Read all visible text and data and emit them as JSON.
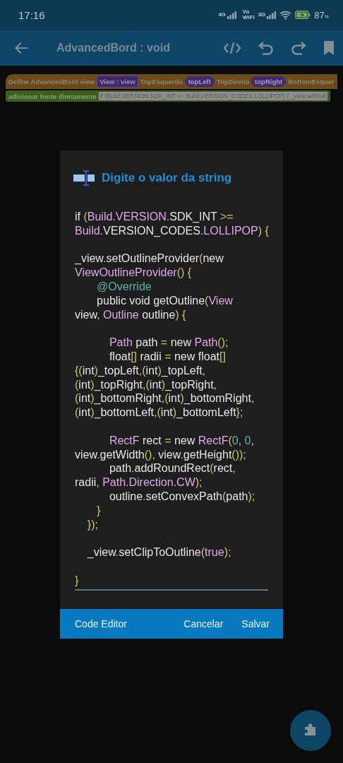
{
  "status_bar": {
    "time": "17:16",
    "signal_1_label": "4G",
    "vowifi_label": [
      "Vo",
      "WiFi"
    ],
    "signal_2_label": "3G",
    "battery": "87",
    "battery_unit": "%"
  },
  "app_bar": {
    "title": "AdvancedBord : void"
  },
  "blocks": [
    {
      "kind": "define",
      "color": "#6b4a1c",
      "parts": [
        {
          "kind": "label",
          "text": "Define AdvancedBord view"
        },
        {
          "kind": "param",
          "text": "View : view"
        },
        {
          "kind": "label",
          "text": "TopEsquerda"
        },
        {
          "kind": "pill",
          "text": "topLeft"
        },
        {
          "kind": "label",
          "text": "TopDireita"
        },
        {
          "kind": "pill",
          "text": "topRight"
        },
        {
          "kind": "label",
          "text": "BottomEsquer"
        }
      ]
    },
    {
      "kind": "statement",
      "color": "#3e5e1c",
      "parts": [
        {
          "kind": "label",
          "text": "adicionar fonte diretamente"
        },
        {
          "kind": "field",
          "text": "if (Build.VERSION.SDK_INT >= Build.VERSION_CODES.LOLLIPOP) { _view.setOutl"
        }
      ]
    }
  ],
  "dialog": {
    "title": "Digite o valor da string",
    "code": [
      [
        [
          {
            "kind": "plain",
            "text": "if "
          },
          {
            "kind": "punct",
            "text": "("
          },
          {
            "kind": "type",
            "text": "Build"
          },
          {
            "kind": "punct",
            "text": "."
          },
          {
            "kind": "type",
            "text": "VERSION"
          },
          {
            "kind": "punct",
            "text": "."
          },
          {
            "kind": "plain",
            "text": "SDK_INT "
          },
          {
            "kind": "punct",
            "text": ">="
          }
        ],
        [
          {
            "kind": "type",
            "text": "Build"
          },
          {
            "kind": "punct",
            "text": "."
          },
          {
            "kind": "plain",
            "text": "VERSION_CODES"
          },
          {
            "kind": "punct",
            "text": "."
          },
          {
            "kind": "type",
            "text": "LOLLIPOP"
          },
          {
            "kind": "punct",
            "text": ") {"
          }
        ]
      ],
      [
        [
          {
            "kind": "plain",
            "text": "_view"
          },
          {
            "kind": "punct",
            "text": "."
          },
          {
            "kind": "plain",
            "text": "setOutlineProvider"
          },
          {
            "kind": "punct",
            "text": "("
          },
          {
            "kind": "plain",
            "text": "new"
          }
        ],
        [
          {
            "kind": "type",
            "text": "ViewOutlineProvider"
          },
          {
            "kind": "punct",
            "text": "() {"
          }
        ],
        [
          {
            "kind": "annot",
            "text": "       @Override"
          }
        ],
        [
          {
            "kind": "plain",
            "text": "       public void getOutline"
          },
          {
            "kind": "punct",
            "text": "("
          },
          {
            "kind": "type",
            "text": "View"
          }
        ],
        [
          {
            "kind": "plain",
            "text": "view"
          },
          {
            "kind": "punct",
            "text": ", "
          },
          {
            "kind": "type",
            "text": "Outline"
          },
          {
            "kind": "plain",
            "text": " outline"
          },
          {
            "kind": "punct",
            "text": ") {"
          }
        ]
      ],
      [
        [
          {
            "kind": "type",
            "text": "           Path"
          },
          {
            "kind": "plain",
            "text": " path "
          },
          {
            "kind": "punct",
            "text": "="
          },
          {
            "kind": "plain",
            "text": " new "
          },
          {
            "kind": "type",
            "text": "Path"
          },
          {
            "kind": "punct",
            "text": "();"
          }
        ],
        [
          {
            "kind": "plain",
            "text": "           float"
          },
          {
            "kind": "punct",
            "text": "[]"
          },
          {
            "kind": "plain",
            "text": " radii "
          },
          {
            "kind": "punct",
            "text": "="
          },
          {
            "kind": "plain",
            "text": " new float"
          },
          {
            "kind": "punct",
            "text": "[]"
          }
        ],
        [
          {
            "kind": "punct",
            "text": "{("
          },
          {
            "kind": "plain",
            "text": "int"
          },
          {
            "kind": "punct",
            "text": ")"
          },
          {
            "kind": "plain",
            "text": "_topLeft"
          },
          {
            "kind": "punct",
            "text": ",("
          },
          {
            "kind": "plain",
            "text": "int"
          },
          {
            "kind": "punct",
            "text": ")"
          },
          {
            "kind": "plain",
            "text": "_topLeft"
          },
          {
            "kind": "punct",
            "text": ","
          }
        ],
        [
          {
            "kind": "punct",
            "text": "("
          },
          {
            "kind": "plain",
            "text": "int"
          },
          {
            "kind": "punct",
            "text": ")"
          },
          {
            "kind": "plain",
            "text": "_topRight"
          },
          {
            "kind": "punct",
            "text": ",("
          },
          {
            "kind": "plain",
            "text": "int"
          },
          {
            "kind": "punct",
            "text": ")"
          },
          {
            "kind": "plain",
            "text": "_topRight"
          },
          {
            "kind": "punct",
            "text": ","
          }
        ],
        [
          {
            "kind": "punct",
            "text": "("
          },
          {
            "kind": "plain",
            "text": "int"
          },
          {
            "kind": "punct",
            "text": ")"
          },
          {
            "kind": "plain",
            "text": "_bottomRight"
          },
          {
            "kind": "punct",
            "text": ",("
          },
          {
            "kind": "plain",
            "text": "int"
          },
          {
            "kind": "punct",
            "text": ")"
          },
          {
            "kind": "plain",
            "text": "_bottomRight"
          },
          {
            "kind": "punct",
            "text": ","
          }
        ],
        [
          {
            "kind": "punct",
            "text": "("
          },
          {
            "kind": "plain",
            "text": "int"
          },
          {
            "kind": "punct",
            "text": ")"
          },
          {
            "kind": "plain",
            "text": "_bottomLeft"
          },
          {
            "kind": "punct",
            "text": ",("
          },
          {
            "kind": "plain",
            "text": "int"
          },
          {
            "kind": "punct",
            "text": ")"
          },
          {
            "kind": "plain",
            "text": "_bottomLeft"
          },
          {
            "kind": "punct",
            "text": "};"
          }
        ]
      ],
      [
        [
          {
            "kind": "type",
            "text": "           RectF"
          },
          {
            "kind": "plain",
            "text": " rect "
          },
          {
            "kind": "punct",
            "text": "="
          },
          {
            "kind": "plain",
            "text": " new "
          },
          {
            "kind": "type",
            "text": "RectF"
          },
          {
            "kind": "punct",
            "text": "("
          },
          {
            "kind": "num",
            "text": "0"
          },
          {
            "kind": "punct",
            "text": ", "
          },
          {
            "kind": "num",
            "text": "0"
          },
          {
            "kind": "punct",
            "text": ","
          }
        ],
        [
          {
            "kind": "plain",
            "text": "view"
          },
          {
            "kind": "punct",
            "text": "."
          },
          {
            "kind": "plain",
            "text": "getWidth"
          },
          {
            "kind": "punct",
            "text": "(), "
          },
          {
            "kind": "plain",
            "text": "view"
          },
          {
            "kind": "punct",
            "text": "."
          },
          {
            "kind": "plain",
            "text": "getHeight"
          },
          {
            "kind": "punct",
            "text": "());"
          }
        ],
        [
          {
            "kind": "plain",
            "text": "           path"
          },
          {
            "kind": "punct",
            "text": "."
          },
          {
            "kind": "plain",
            "text": "addRoundRect"
          },
          {
            "kind": "punct",
            "text": "("
          },
          {
            "kind": "plain",
            "text": "rect"
          },
          {
            "kind": "punct",
            "text": ","
          }
        ],
        [
          {
            "kind": "plain",
            "text": "radii"
          },
          {
            "kind": "punct",
            "text": ", "
          },
          {
            "kind": "type",
            "text": "Path"
          },
          {
            "kind": "punct",
            "text": "."
          },
          {
            "kind": "type",
            "text": "Direction"
          },
          {
            "kind": "punct",
            "text": "."
          },
          {
            "kind": "type",
            "text": "CW"
          },
          {
            "kind": "punct",
            "text": ");"
          }
        ],
        [
          {
            "kind": "plain",
            "text": "           outline"
          },
          {
            "kind": "punct",
            "text": "."
          },
          {
            "kind": "plain",
            "text": "setConvexPath"
          },
          {
            "kind": "punct",
            "text": "("
          },
          {
            "kind": "plain",
            "text": "path"
          },
          {
            "kind": "punct",
            "text": ");"
          }
        ],
        [
          {
            "kind": "punct",
            "text": "       }"
          }
        ],
        [
          {
            "kind": "punct",
            "text": "    });"
          }
        ]
      ],
      [
        [
          {
            "kind": "plain",
            "text": "    _view"
          },
          {
            "kind": "punct",
            "text": "."
          },
          {
            "kind": "plain",
            "text": "setClipToOutline"
          },
          {
            "kind": "punct",
            "text": "("
          },
          {
            "kind": "type",
            "text": "true"
          },
          {
            "kind": "punct",
            "text": ");"
          }
        ]
      ],
      [
        [
          {
            "kind": "punct",
            "text": "}"
          }
        ]
      ]
    ],
    "buttons": [
      {
        "kind": "left",
        "label": "Code Editor"
      },
      {
        "kind": "right",
        "label": "Cancelar"
      },
      {
        "kind": "right",
        "label": "Salvar"
      }
    ]
  }
}
